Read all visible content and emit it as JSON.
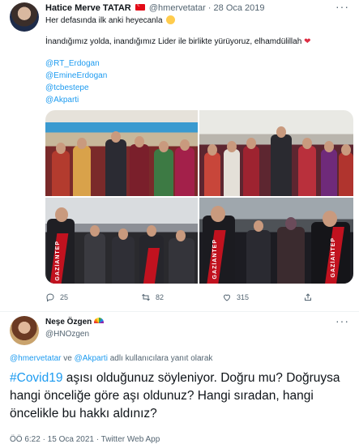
{
  "tweet1": {
    "author_name": "Hatice Merve TATAR",
    "author_handle": "@hmervetatar",
    "separator": "·",
    "date": "28 Oca 2019",
    "line1": "Her defasında ilk anki heyecanla",
    "line2": "İnandığımız yolda, inandığımız Lider ile birlikte yürüyoruz, elhamdülillah",
    "mentions": [
      "@RT_Erdogan",
      "@EmineErdogan",
      "@tcbestepe",
      "@Akparti"
    ],
    "photo_text": [
      "GAZİANTEP",
      "GAZİANTEP",
      "GAZİANTEP"
    ],
    "actions": {
      "reply_count": "25",
      "retweet_count": "82",
      "like_count": "315"
    }
  },
  "tweet2": {
    "author_name": "Neşe Özgen",
    "author_handle": "@HNOzgen",
    "reply_to": {
      "handle1": "@hmervetatar",
      "connector": "ve",
      "handle2": "@Akparti",
      "suffix": "adlı kullanıcılara yanıt olarak"
    },
    "hashtag": "#Covid19",
    "body": " aşısı olduğunuz söyleniyor. Doğru mu? Doğruysa hangi önceliğe göre aşı oldunuz? Hangi sıradan, hangi öncelikle bu hakkı aldınız?",
    "timestamp": "ÖÖ 6:22 · 15 Oca 2021 · Twitter Web App"
  },
  "colors": {
    "link": "#1d9bf0",
    "text": "#0f1419",
    "muted": "#536471",
    "heart": "#dd2e44",
    "scarf": "#c1121f"
  },
  "icons": [
    "reply-icon",
    "retweet-icon",
    "like-icon",
    "share-icon",
    "more-icon",
    "smile-emoji",
    "heart-emoji",
    "rainbow-emoji",
    "turkey-flag"
  ]
}
